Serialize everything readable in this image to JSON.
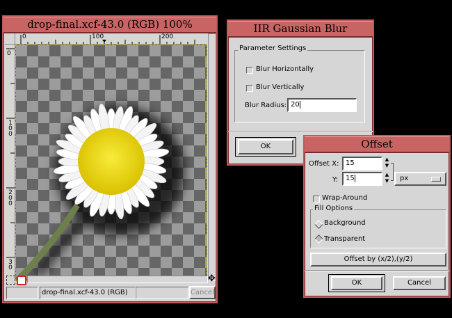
{
  "image_window": {
    "title": "drop-final.xcf-43.0 (RGB) 100%",
    "hruler_labels": [
      "0",
      "100",
      "200"
    ],
    "vruler_labels": [
      "0",
      "100",
      "200",
      "30"
    ],
    "status_text": "drop-final.xcf-43.0 (RGB)",
    "cancel_label": "Cancel"
  },
  "blur_dialog": {
    "title": "IIR Gaussian Blur",
    "frame_title": "Parameter Settings",
    "blur_h_label": "Blur Horizontally",
    "blur_v_label": "Blur Vertically",
    "radius_label": "Blur Radius:",
    "radius_value": "20",
    "ok_label": "OK"
  },
  "offset_dialog": {
    "title": "Offset",
    "offset_x_label": "Offset X:",
    "offset_x_value": "15",
    "offset_y_label": "Y:",
    "offset_y_value": "15",
    "unit": "px",
    "wrap_label": "Wrap-Around",
    "fill_title": "Fill Options",
    "fill_background": "Background",
    "fill_transparent": "Transparent",
    "offset_half_label": "Offset by (x/2),(y/2)",
    "ok_label": "OK",
    "cancel_label": "Cancel"
  }
}
